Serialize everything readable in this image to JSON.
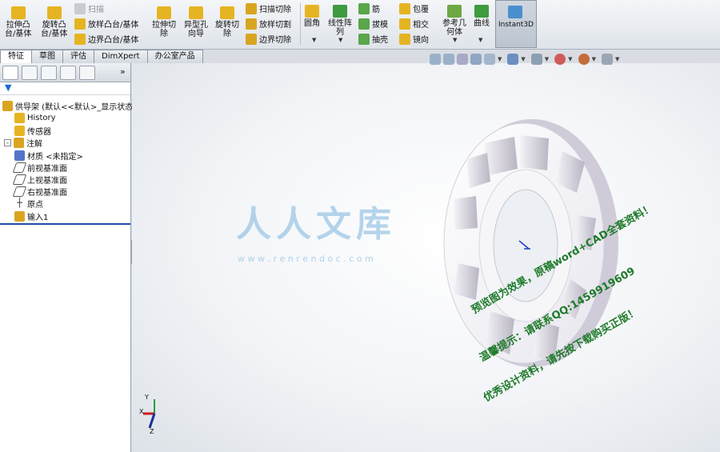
{
  "ribbon": {
    "extrude_boss": "拉伸凸\n台/基体",
    "revolve_boss": "旋转凸\n台/基体",
    "sweep": "扫描",
    "loft_boss": "放样凸台/基体",
    "boundary_boss": "边界凸台/基体",
    "extrude_cut": "拉伸切\n除",
    "hole_wizard": "异型孔\n向导",
    "revolve_cut": "旋转切\n除",
    "swept_cut": "扫描切除",
    "lofted_cut": "放样切割",
    "boundary_cut": "边界切除",
    "fillet": "圆角",
    "linear_pattern": "线性阵\n列",
    "rib": "筋",
    "draft": "拔模",
    "shell": "抽壳",
    "wrap": "包覆",
    "intersect": "相交",
    "mirror": "镜向",
    "ref_geometry": "参考几\n何体",
    "curves": "曲线",
    "instant3d": "Instant3D"
  },
  "tabs": [
    "特征",
    "草图",
    "评估",
    "DimXpert",
    "办公室产品"
  ],
  "tree": {
    "root": "供导架 (默认<<默认>_显示状态",
    "items": [
      "History",
      "传感器",
      "注解",
      "材质 <未指定>",
      "前视基准面",
      "上视基准面",
      "右视基准面",
      "原点",
      "输入1"
    ]
  },
  "watermark": {
    "brand": "人人文库",
    "url": "w w w . r e n r e n d o c . c o m",
    "line1": "原稿word+CAD全套资料!",
    "line2": "QQ:1459919609",
    "line3": "预览图为效果，原稿word+CAD全套资料！",
    "line4": "温馨提示：请联系QQ:1459919609",
    "line5": "优秀设计资料，请先按下载购买正版！"
  },
  "triad": {
    "x": "X",
    "y": "Y",
    "z": "Z"
  },
  "colors": {
    "accent": "#1a6bd1",
    "watermark_green": "#1e7a2a",
    "watermark_blue": "#7fb6dd"
  }
}
